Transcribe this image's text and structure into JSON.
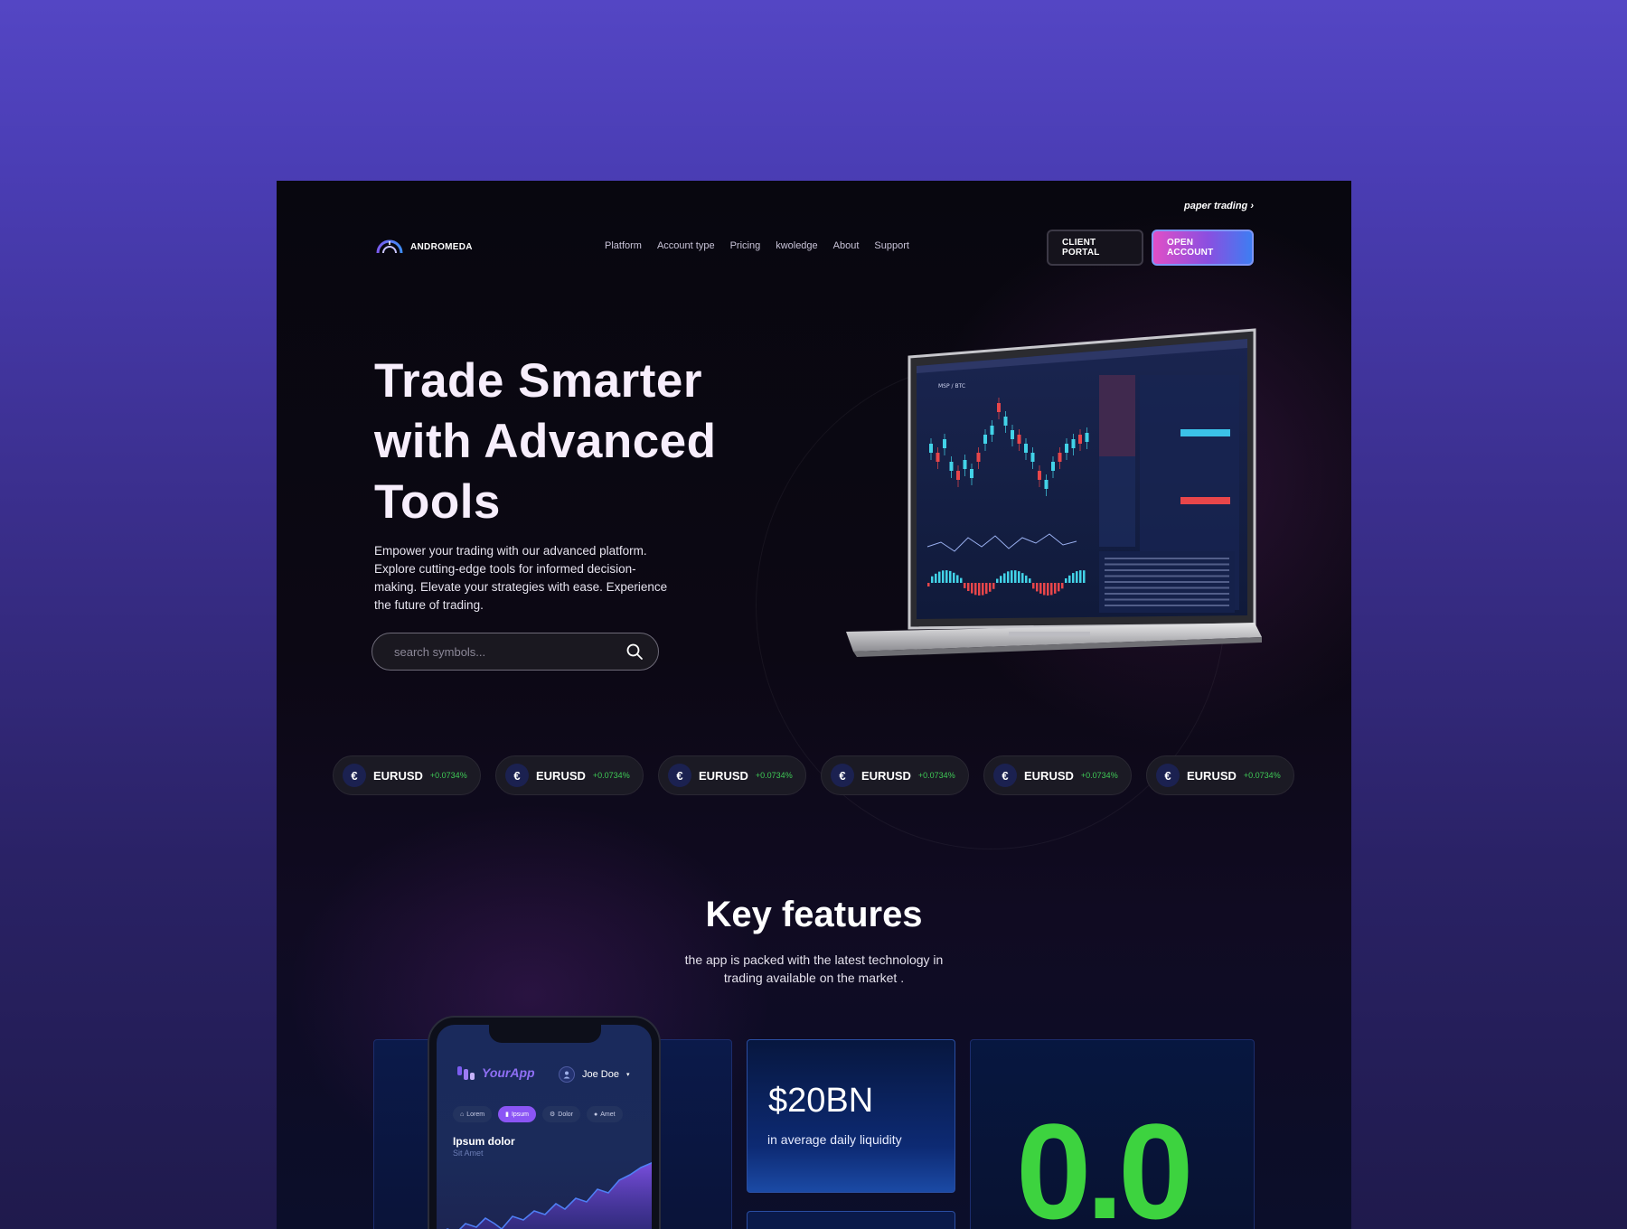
{
  "topbar": {
    "paper_trading": "paper trading ›"
  },
  "brand": {
    "name": "ANDROMEDA"
  },
  "nav": {
    "items": [
      "Platform",
      "Account type",
      "Pricing",
      "kwoledge",
      "About",
      "Support"
    ]
  },
  "buttons": {
    "client_portal": "CLIENT PORTAL",
    "open_account": "OPEN ACCOUNT"
  },
  "hero": {
    "title_lines": [
      "Trade Smarter",
      "with Advanced",
      "Tools"
    ],
    "description": "Empower your trading with our advanced platform. Explore cutting-edge tools for informed decision-making. Elevate your strategies with ease. Experience the future of trading.",
    "search_placeholder": "search symbols..."
  },
  "laptop_screen": {
    "pair": "MSP / BTC"
  },
  "tickers": [
    {
      "symbol": "EURUSD",
      "change": "+0.0734%",
      "icon": "euro-coin-icon"
    },
    {
      "symbol": "EURUSD",
      "change": "+0.0734%",
      "icon": "euro-coin-icon"
    },
    {
      "symbol": "EURUSD",
      "change": "+0.0734%",
      "icon": "euro-coin-icon"
    },
    {
      "symbol": "EURUSD",
      "change": "+0.0734%",
      "icon": "euro-coin-icon"
    },
    {
      "symbol": "EURUSD",
      "change": "+0.0734%",
      "icon": "euro-coin-icon"
    },
    {
      "symbol": "EURUSD",
      "change": "+0.0734%",
      "icon": "euro-coin-icon"
    }
  ],
  "features": {
    "title": "Key features",
    "subtitle_lines": [
      "the app is packed with the latest technology in",
      "trading available on the market ."
    ]
  },
  "phone_app": {
    "app_name": "YourApp",
    "user_name": "Joe Doe",
    "pills": [
      "Lorem",
      "Ipsum",
      "Dolor",
      "Amet"
    ],
    "active_pill": "Ipsum",
    "title": "Ipsum dolor",
    "subtitle": "Sit Amet"
  },
  "liquidity_card": {
    "value": "$20BN",
    "label": "in average daily liquidity"
  },
  "spread_card": {
    "value": "0.0"
  },
  "colors": {
    "accent_pink": "#e04fc7",
    "accent_blue": "#3e7df2",
    "positive": "#3fca56",
    "spread_green": "#3dd33f"
  }
}
